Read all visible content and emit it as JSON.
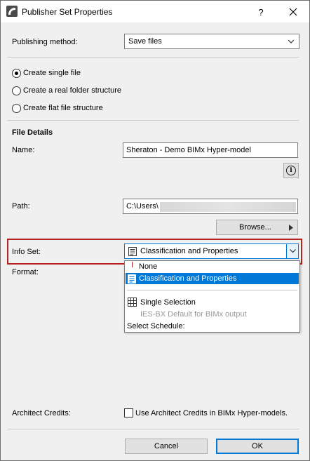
{
  "window": {
    "title": "Publisher Set Properties",
    "help_label": "?",
    "close_label": "✕"
  },
  "publishing": {
    "label": "Publishing method:",
    "value": "Save files"
  },
  "structure_options": [
    {
      "label": "Create single file",
      "selected": true
    },
    {
      "label": "Create a real folder structure",
      "selected": false
    },
    {
      "label": "Create flat file structure",
      "selected": false
    }
  ],
  "file_details": {
    "heading": "File Details",
    "name_label": "Name:",
    "name_value": "Sheraton - Demo BIMx Hyper-model",
    "path_label": "Path:",
    "path_value": "C:\\Users\\",
    "browse_label": "Browse..."
  },
  "info_set": {
    "label": "Info Set:",
    "value": "Classification and Properties",
    "options": [
      {
        "label": "None",
        "state": "normal"
      },
      {
        "label": "Classification and Properties",
        "state": "selected"
      },
      {
        "label": "Single Selection",
        "state": "normal"
      },
      {
        "label": "IES-BX Default for BIMx output",
        "state": "disabled"
      },
      {
        "label": "Select Schedule:",
        "state": "normal"
      }
    ]
  },
  "format": {
    "label": "Format:"
  },
  "credits": {
    "label": "Architect Credits:",
    "checkbox_label": "Use Architect Credits in BIMx Hyper-models.",
    "checked": false
  },
  "footer": {
    "cancel_label": "Cancel",
    "ok_label": "OK"
  },
  "colors": {
    "accent": "#0078d7",
    "highlight": "#b22222"
  }
}
